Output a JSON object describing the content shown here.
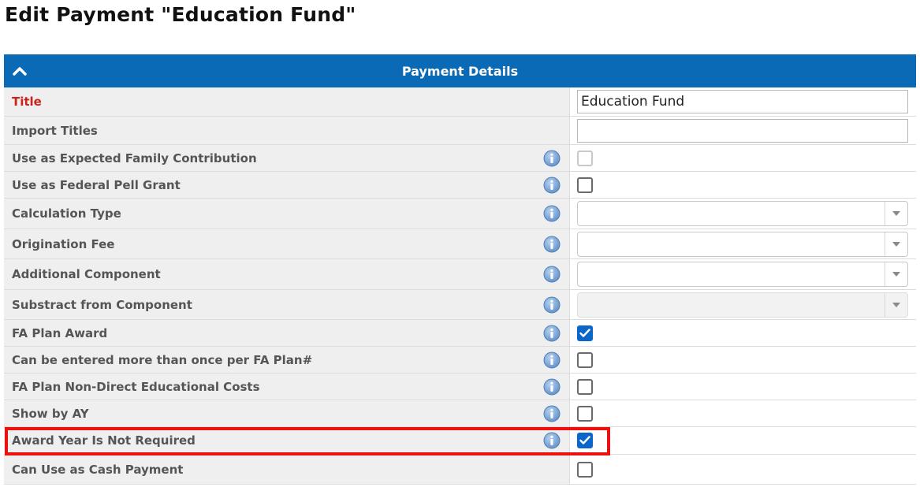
{
  "page": {
    "title": "Edit Payment \"Education Fund\""
  },
  "panel": {
    "header": "Payment Details"
  },
  "rows": [
    {
      "label": "Title",
      "type": "text",
      "value": "Education Fund",
      "required": true,
      "info": false
    },
    {
      "label": "Import Titles",
      "type": "text",
      "value": "",
      "info": false
    },
    {
      "label": "Use as Expected Family Contribution",
      "type": "checkbox",
      "checked": false,
      "disabled": true,
      "info": true
    },
    {
      "label": "Use as Federal Pell Grant",
      "type": "checkbox",
      "checked": false,
      "info": true
    },
    {
      "label": "Calculation Type",
      "type": "select",
      "value": "",
      "info": true
    },
    {
      "label": "Origination Fee",
      "type": "select",
      "value": "",
      "info": true
    },
    {
      "label": "Additional Component",
      "type": "select",
      "value": "",
      "info": true
    },
    {
      "label": "Substract from Component",
      "type": "select",
      "value": "",
      "disabled": true,
      "info": true
    },
    {
      "label": "FA Plan Award",
      "type": "checkbox",
      "checked": true,
      "info": true
    },
    {
      "label": "Can be entered more than once per FA Plan#",
      "type": "checkbox",
      "checked": false,
      "info": true
    },
    {
      "label": "FA Plan Non-Direct Educational Costs",
      "type": "checkbox",
      "checked": false,
      "info": true
    },
    {
      "label": "Show by AY",
      "type": "checkbox",
      "checked": false,
      "info": true
    },
    {
      "label": "Award Year Is Not Required",
      "type": "checkbox",
      "checked": true,
      "info": true,
      "highlighted": true
    },
    {
      "label": "Can Use as Cash Payment",
      "type": "checkbox",
      "checked": false,
      "info": false
    }
  ],
  "colors": {
    "header_bg": "#0a6ab6",
    "required_label": "#c8251a",
    "highlight_border": "#ee1010",
    "checkbox_checked": "#0b66c9"
  },
  "icons": {
    "collapse": "chevron-up-icon",
    "info": "info-icon",
    "select_arrow": "chevron-down-icon",
    "check": "checkmark-icon"
  }
}
